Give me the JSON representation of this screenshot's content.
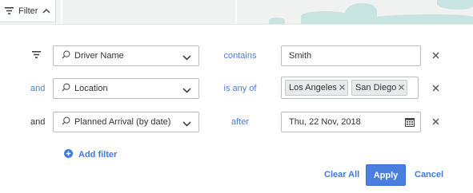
{
  "toolbar": {
    "filter_label": "Filter"
  },
  "filters": [
    {
      "conjunction": "",
      "field": "Driver Name",
      "operator": "contains",
      "value": "Smith"
    },
    {
      "conjunction": "and",
      "field": "Location",
      "operator": "is any of",
      "tags": [
        "Los Angeles",
        "San Diego"
      ]
    },
    {
      "conjunction": "and",
      "field": "Planned Arrival (by date)",
      "operator": "after",
      "value": "Thu, 22 Nov, 2018"
    }
  ],
  "add_filter_label": "Add filter",
  "actions": {
    "clear_all": "Clear All",
    "apply": "Apply",
    "cancel": "Cancel"
  },
  "colors": {
    "accent": "#4a7fe0",
    "link": "#3e7bd9",
    "water": "#c7e4e0"
  }
}
